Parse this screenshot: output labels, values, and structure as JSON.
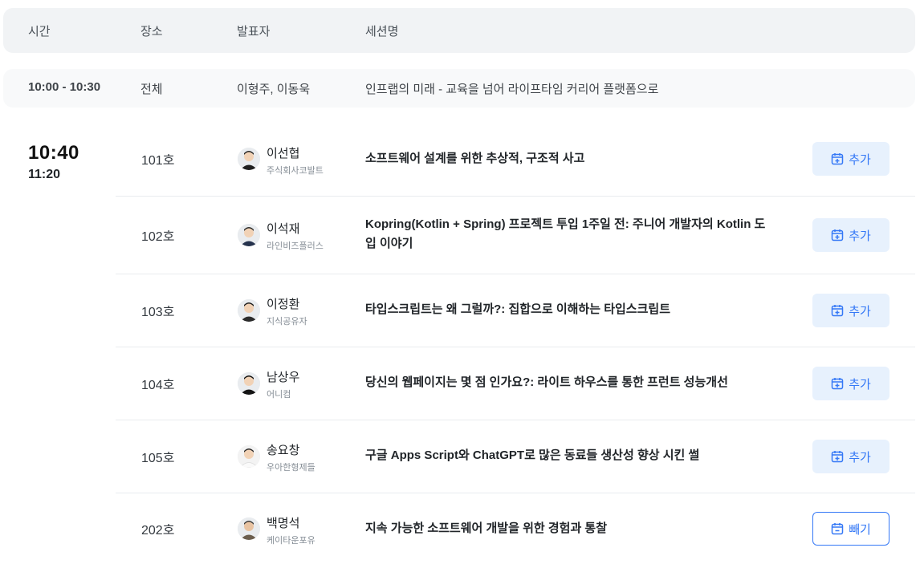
{
  "header": {
    "time": "시간",
    "place": "장소",
    "speaker": "발표자",
    "session": "세션명"
  },
  "keynote": {
    "time": "10:00 - 10:30",
    "place": "전체",
    "speakers": "이형주, 이동욱",
    "title": "인프랩의 미래 - 교육을 넘어 라이프타임 커리어 플랫폼으로"
  },
  "slot": {
    "start": "10:40",
    "end": "11:20"
  },
  "sessions": [
    {
      "room": "101호",
      "speaker": "이선협",
      "org": "주식회사코발트",
      "title": "소프트웨어 설계를 위한 추상적, 구조적 사고",
      "action": "추가",
      "action_icon": "calendar-plus-icon"
    },
    {
      "room": "102호",
      "speaker": "이석재",
      "org": "라인비즈플러스",
      "title": "Kopring(Kotlin + Spring) 프로젝트 투입 1주일 전: 주니어 개발자의 Kotlin 도입 이야기",
      "action": "추가",
      "action_icon": "calendar-plus-icon"
    },
    {
      "room": "103호",
      "speaker": "이정환",
      "org": "지식공유자",
      "title": "타입스크립트는 왜 그럴까?: 집합으로 이해하는 타입스크립트",
      "action": "추가",
      "action_icon": "calendar-plus-icon"
    },
    {
      "room": "104호",
      "speaker": "남상우",
      "org": "어니컴",
      "title": "당신의 웹페이지는 몇 점 인가요?: 라이트 하우스를 통한 프런트 성능개선",
      "action": "추가",
      "action_icon": "calendar-plus-icon"
    },
    {
      "room": "105호",
      "speaker": "송요창",
      "org": "우아한형제들",
      "title": "구글 Apps Script와 ChatGPT로 많은 동료들 생산성 향상 시킨 썰",
      "action": "추가",
      "action_icon": "calendar-plus-icon"
    },
    {
      "room": "202호",
      "speaker": "백명석",
      "org": "케이타운포유",
      "title": "지속 가능한 소프트웨어 개발을 위한 경험과 통찰",
      "action": "빼기",
      "action_icon": "calendar-minus-icon"
    }
  ],
  "colors": {
    "accent": "#3478f6",
    "accent_bg": "#e7f1fd",
    "header_bg": "#f1f3f5",
    "keynote_bg": "#f8f9fa",
    "divider": "#e9ecef"
  }
}
